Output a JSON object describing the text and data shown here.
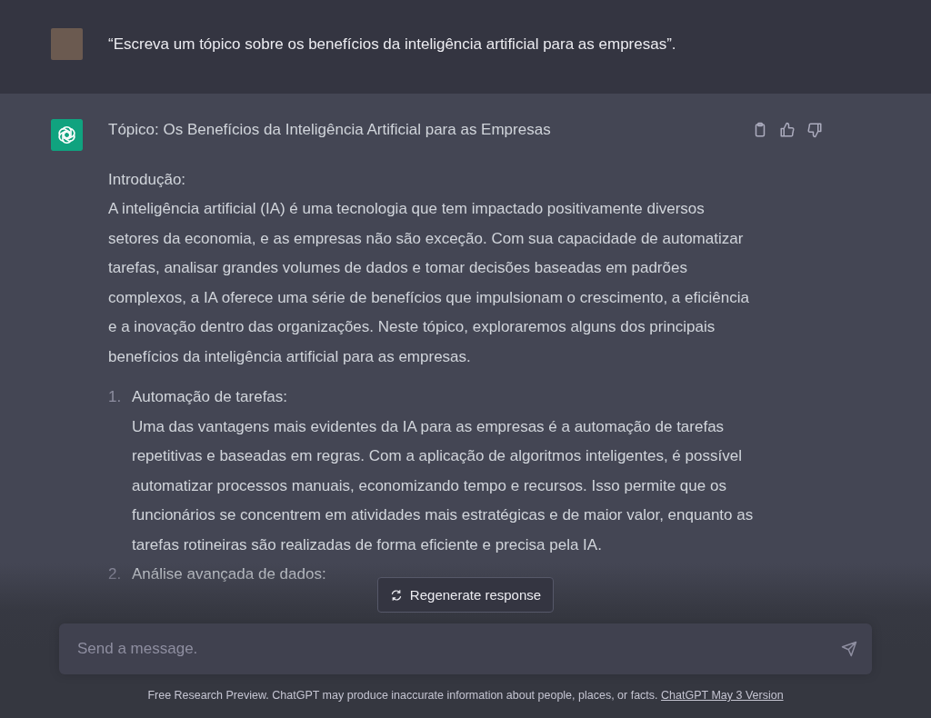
{
  "user_message": {
    "text": "“Escreva um tópico sobre os benefícios da inteligência artificial para as empresas”."
  },
  "assistant_message": {
    "title": "Tópico: Os Benefícios da Inteligência Artificial para as Empresas",
    "actions": [
      {
        "kind": "copy"
      },
      {
        "kind": "like"
      },
      {
        "kind": "dislike"
      }
    ],
    "intro_heading": "Introdução:",
    "intro": "A inteligência artificial (IA) é uma tecnologia que tem impactado positivamente diversos setores da economia, e as empresas não são exceção. Com sua capacidade de automatizar tarefas, analisar grandes volumes de dados e tomar decisões baseadas em padrões complexos, a IA oferece uma série de benefícios que impulsionam o crescimento, a eficiência e a inovação dentro das organizações. Neste tópico, exploraremos alguns dos principais benefícios da inteligência artificial para as empresas.",
    "items": [
      {
        "number": "1.",
        "heading": "Automação de tarefas:",
        "text": "Uma das vantagens mais evidentes da IA para as empresas é a automação de tarefas repetitivas e baseadas em regras. Com a aplicação de algoritmos inteligentes, é possível automatizar processos manuais, economizando tempo e recursos. Isso permite que os funcionários se concentrem em atividades mais estratégicas e de maior valor, enquanto as tarefas rotineiras são realizadas de forma eficiente e precisa pela IA."
      },
      {
        "number": "2.",
        "heading": "Análise avançada de dados:"
      }
    ]
  },
  "regenerate_button": {
    "label": "Regenerate response"
  },
  "composer": {
    "placeholder": "Send a message."
  },
  "footer": {
    "text": "Free Research Preview. ChatGPT may produce inaccurate information about people, places, or facts.",
    "link": "ChatGPT May 3 Version"
  }
}
